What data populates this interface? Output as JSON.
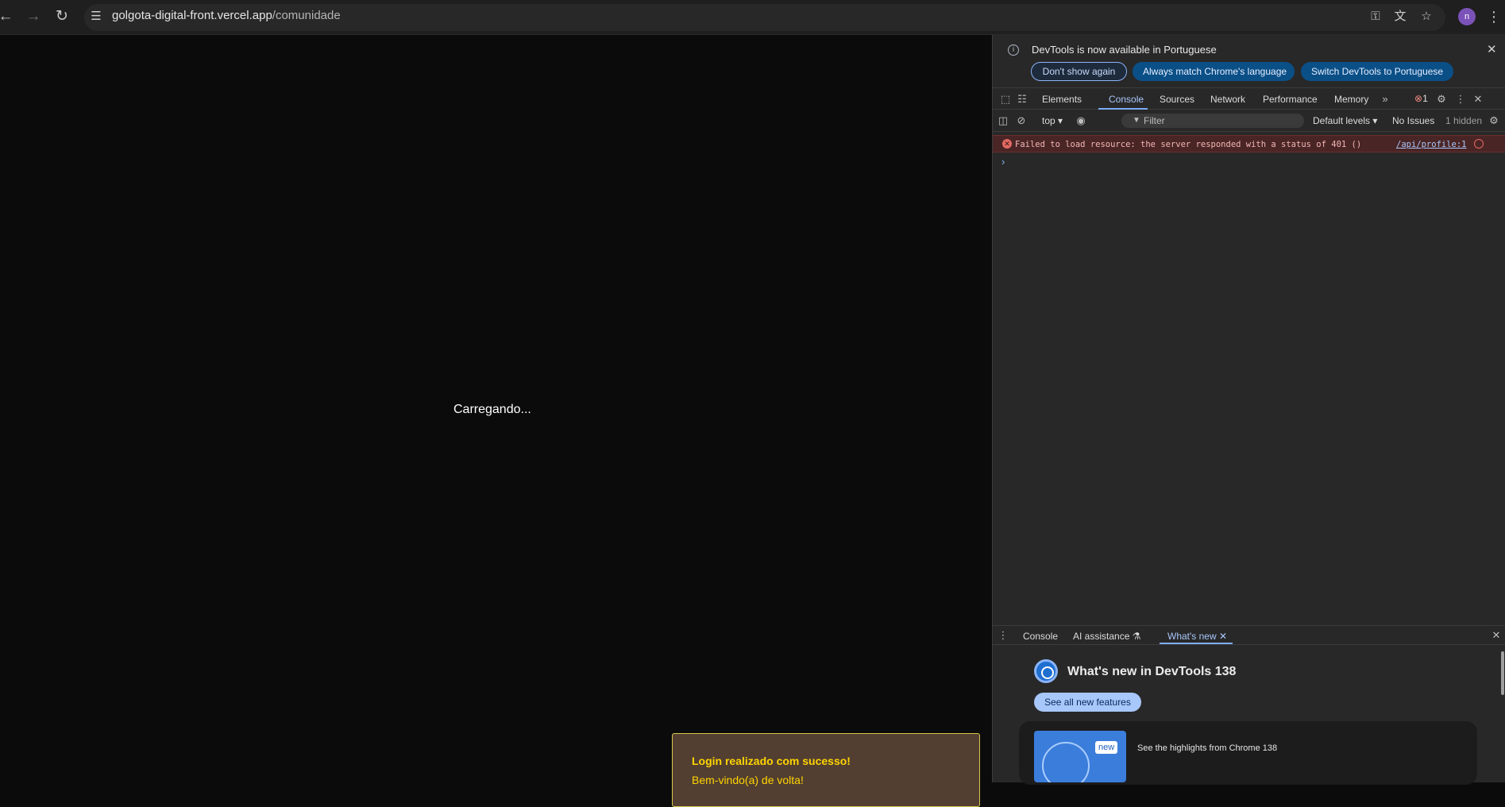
{
  "browser": {
    "url_host": "golgota-digital-front.vercel.app",
    "url_path": "/comunidade",
    "back_icon": "arrow-left-icon",
    "forward_icon": "arrow-right-icon",
    "reload_icon": "reload-icon",
    "profile_initial": "n"
  },
  "page": {
    "loading_text": "Carregando...",
    "toast": {
      "title": "Login realizado com sucesso!",
      "message": "Bem-vindo(a) de volta!"
    }
  },
  "devtools": {
    "infobar": {
      "text": "DevTools is now available in Portuguese",
      "dont_show": "Don't show again",
      "always_match": "Always match Chrome's language",
      "switch": "Switch DevTools to Portuguese"
    },
    "tabs": [
      "Elements",
      "Console",
      "Sources",
      "Network",
      "Performance",
      "Memory"
    ],
    "error_count": "1",
    "filterbar": {
      "context": "top",
      "filter_placeholder": "Filter",
      "levels": "Default levels",
      "issues": "No Issues",
      "hidden": "1 hidden"
    },
    "console": {
      "error_message": "Failed to load resource: the server responded with a status of 401 ()",
      "error_source": "/api/profile:1",
      "prompt": "›"
    },
    "drawer": {
      "tabs": [
        "Console",
        "AI assistance",
        "What's new"
      ],
      "whats_new_title": "What's new in DevTools 138",
      "see_all": "See all new features",
      "new_badge": "new",
      "highlight_text": "See the highlights from Chrome 138"
    }
  }
}
